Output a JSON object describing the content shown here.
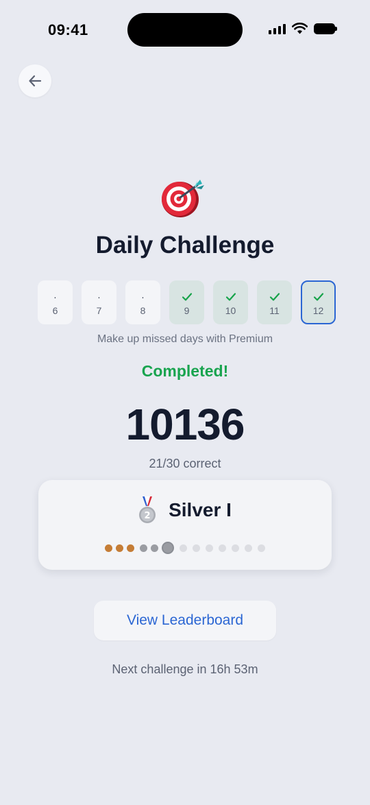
{
  "status_bar": {
    "time": "09:41"
  },
  "header": {
    "back_icon": "arrow-left-icon"
  },
  "challenge": {
    "icon": "target-dart-icon",
    "title": "Daily Challenge",
    "days": [
      {
        "label": "6",
        "state": "missed"
      },
      {
        "label": "7",
        "state": "missed"
      },
      {
        "label": "8",
        "state": "missed"
      },
      {
        "label": "9",
        "state": "done"
      },
      {
        "label": "10",
        "state": "done"
      },
      {
        "label": "11",
        "state": "done"
      },
      {
        "label": "12",
        "state": "today-done"
      }
    ],
    "premium_note": "Make up missed days with Premium",
    "status": "Completed!",
    "score": "10136",
    "correct": "21/30 correct"
  },
  "rank": {
    "icon": "silver-medal-icon",
    "name": "Silver I",
    "progress": {
      "bronze_steps": 3,
      "silver_steps": 2,
      "current_step": 6,
      "total_steps": 13
    }
  },
  "actions": {
    "leaderboard_label": "View Leaderboard"
  },
  "footer": {
    "next_challenge": "Next challenge in 16h 53m"
  },
  "colors": {
    "background": "#e8eaf1",
    "accent_blue": "#2b66d3",
    "success_green": "#19a44f",
    "bronze": "#c57d36",
    "silver": "#9a9ca2"
  }
}
